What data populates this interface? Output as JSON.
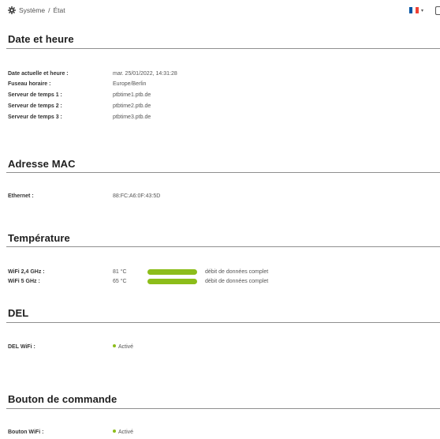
{
  "breadcrumb": {
    "section": "Système",
    "separator": "/",
    "page": "État"
  },
  "language": {
    "selected": "FR",
    "flag_colors": [
      "#0055a4",
      "#ffffff",
      "#ef4135"
    ]
  },
  "sections": {
    "datetime": {
      "title": "Date et heure",
      "rows": [
        {
          "label": "Date actuelle et heure :",
          "value": "mar. 25/01/2022, 14:31:28"
        },
        {
          "label": "Fuseau horaire :",
          "value": "Europe/Berlin"
        },
        {
          "label": "Serveur de temps 1 :",
          "value": "ptbtime1.ptb.de"
        },
        {
          "label": "Serveur de temps 2 :",
          "value": "ptbtime2.ptb.de"
        },
        {
          "label": "Serveur de temps 3 :",
          "value": "ptbtime3.ptb.de"
        }
      ]
    },
    "mac": {
      "title": "Adresse MAC",
      "rows": [
        {
          "label": "Ethernet :",
          "value": "88:FC:A6:0F:43:5D"
        }
      ]
    },
    "temperature": {
      "title": "Température",
      "rows": [
        {
          "label": "WiFi 2,4 GHz :",
          "value": "81 °C",
          "level": 1.0,
          "status": "débit de données complet"
        },
        {
          "label": "WiFi 5 GHz :",
          "value": "65 °C",
          "level": 1.0,
          "status": "débit de données complet"
        }
      ]
    },
    "led": {
      "title": "DEL",
      "rows": [
        {
          "label": "DEL WiFi :",
          "value": "Activé"
        }
      ]
    },
    "button": {
      "title": "Bouton de commande",
      "rows": [
        {
          "label": "Bouton WiFi :",
          "value": "Activé"
        }
      ]
    }
  },
  "colors": {
    "accent_green": "#8cbd1a",
    "rule": "#8f8f8f"
  }
}
